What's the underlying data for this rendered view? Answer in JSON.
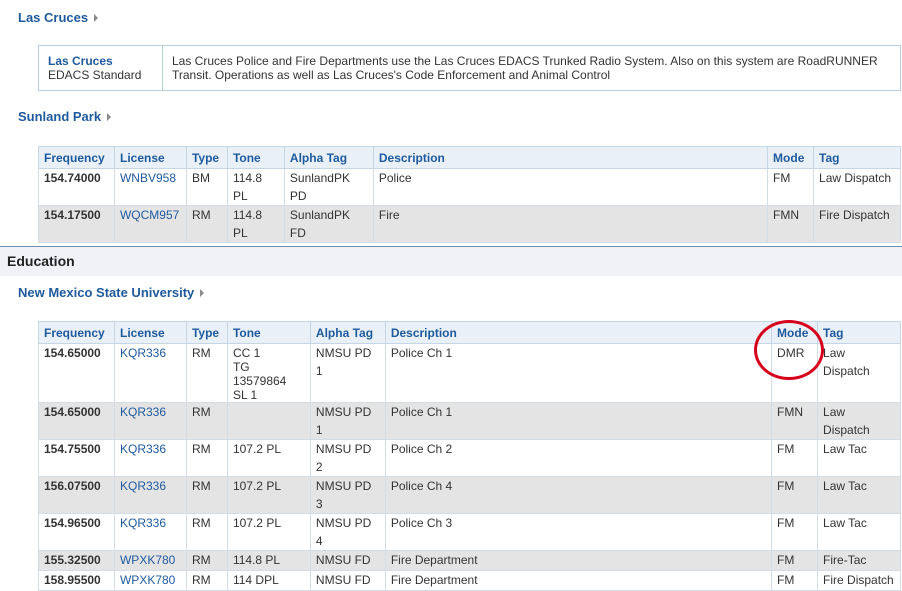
{
  "agencies": {
    "las_cruces": {
      "title": "Las Cruces"
    },
    "sunland_park": {
      "title": "Sunland Park"
    },
    "nmsu": {
      "title": "New Mexico State University"
    }
  },
  "system_box": {
    "name": "Las Cruces",
    "type": "EDACS Standard",
    "description": "Las Cruces Police and Fire Departments use the Las Cruces EDACS Trunked Radio System. Also on this system are RoadRUNNER Transit. Operations as well as Las Cruces's Code Enforcement and Animal Control"
  },
  "columns": [
    "Frequency",
    "License",
    "Type",
    "Tone",
    "Alpha Tag",
    "Description",
    "Mode",
    "Tag"
  ],
  "category": "Education",
  "sunland_rows": [
    {
      "freq": "154.74000",
      "license": "WNBV958",
      "type": "BM",
      "tone": "114.8 PL",
      "alpha": "SunlandPK PD",
      "desc": "Police",
      "mode": "FM",
      "tag": "Law Dispatch"
    },
    {
      "freq": "154.17500",
      "license": "WQCM957",
      "type": "RM",
      "tone": "114.8 PL",
      "alpha": "SunlandPK FD",
      "desc": "Fire",
      "mode": "FMN",
      "tag": "Fire Dispatch"
    }
  ],
  "nmsu_first_row": {
    "freq": "154.65000",
    "license": "KQR336",
    "type": "RM",
    "tone_lines": [
      "CC 1",
      "TG 13579864",
      "SL 1"
    ],
    "alpha": "NMSU PD 1",
    "desc": "Police Ch 1",
    "mode": "DMR",
    "tag": "Law Dispatch"
  },
  "nmsu_rows": [
    {
      "freq": "154.65000",
      "license": "KQR336",
      "type": "RM",
      "tone": "",
      "alpha": "NMSU PD 1",
      "desc": "Police Ch 1",
      "mode": "FMN",
      "tag": "Law Dispatch"
    },
    {
      "freq": "154.75500",
      "license": "KQR336",
      "type": "RM",
      "tone": "107.2 PL",
      "alpha": "NMSU PD 2",
      "desc": "Police Ch 2",
      "mode": "FM",
      "tag": "Law Tac"
    },
    {
      "freq": "156.07500",
      "license": "KQR336",
      "type": "RM",
      "tone": "107.2 PL",
      "alpha": "NMSU PD 3",
      "desc": "Police Ch 4",
      "mode": "FM",
      "tag": "Law Tac"
    },
    {
      "freq": "154.96500",
      "license": "KQR336",
      "type": "RM",
      "tone": "107.2 PL",
      "alpha": "NMSU PD 4",
      "desc": "Police Ch 3",
      "mode": "FM",
      "tag": "Law Tac"
    },
    {
      "freq": "155.32500",
      "license": "WPXK780",
      "type": "RM",
      "tone": "114.8 PL",
      "alpha": "NMSU FD",
      "desc": "Fire Department",
      "mode": "FM",
      "tag": "Fire-Tac"
    },
    {
      "freq": "158.95500",
      "license": "WPXK780",
      "type": "RM",
      "tone": "114 DPL",
      "alpha": "NMSU FD",
      "desc": "Fire Department",
      "mode": "FM",
      "tag": "Fire Dispatch"
    }
  ],
  "annotation": {
    "color": "#d6001c",
    "target": "DMR"
  }
}
